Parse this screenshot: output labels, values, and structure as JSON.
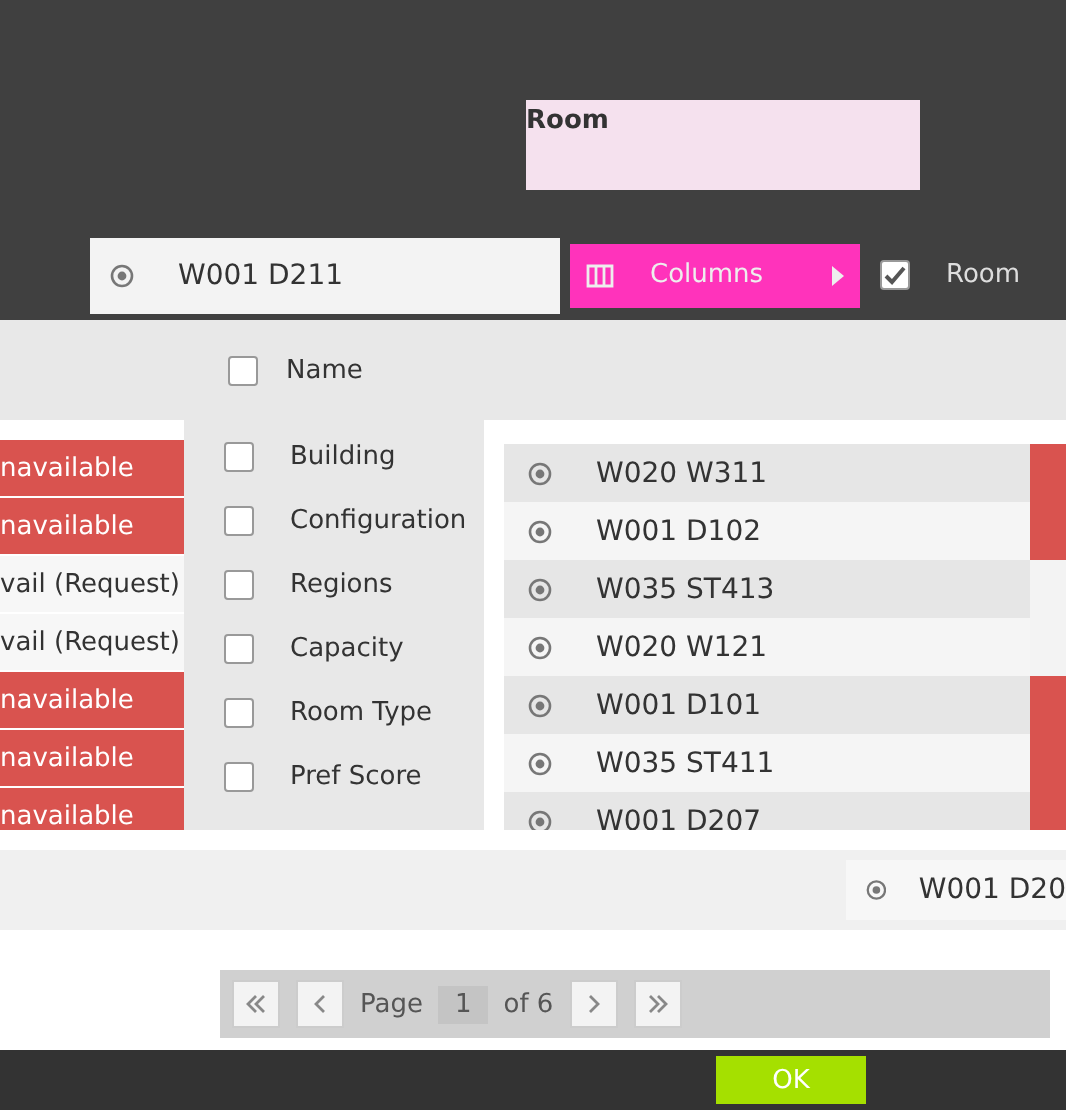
{
  "header": {
    "title": "Room"
  },
  "selected_room": {
    "name": "W001 D211"
  },
  "menu": {
    "label": "Columns",
    "sub_item": {
      "label": "Room",
      "checked": true
    }
  },
  "list_header": {
    "label": "Name",
    "checked": false
  },
  "statuses": [
    {
      "label": "navailable",
      "kind": "unavailable"
    },
    {
      "label": "navailable",
      "kind": "unavailable"
    },
    {
      "label": "vail (Request)",
      "kind": "request"
    },
    {
      "label": "vail (Request)",
      "kind": "request"
    },
    {
      "label": "navailable",
      "kind": "unavailable"
    },
    {
      "label": "navailable",
      "kind": "unavailable"
    },
    {
      "label": "navailable",
      "kind": "unavailable"
    }
  ],
  "column_options": [
    {
      "label": "Building",
      "checked": false
    },
    {
      "label": "Configuration",
      "checked": false
    },
    {
      "label": "Regions",
      "checked": false
    },
    {
      "label": "Capacity",
      "checked": false
    },
    {
      "label": "Room Type",
      "checked": false
    },
    {
      "label": "Pref Score",
      "checked": false
    }
  ],
  "rooms": [
    {
      "name": "W020 W311",
      "available": false
    },
    {
      "name": "W001 D102",
      "available": false
    },
    {
      "name": "W035 ST413",
      "available": true
    },
    {
      "name": "W020 W121",
      "available": true
    },
    {
      "name": "W001 D101",
      "available": false
    },
    {
      "name": "W035 ST411",
      "available": false
    },
    {
      "name": "W001 D207",
      "available": false
    }
  ],
  "footer_room": {
    "name": "W001 D20"
  },
  "pager": {
    "label": "Page",
    "page": "1",
    "of": "of 6"
  },
  "ok_button": "OK"
}
